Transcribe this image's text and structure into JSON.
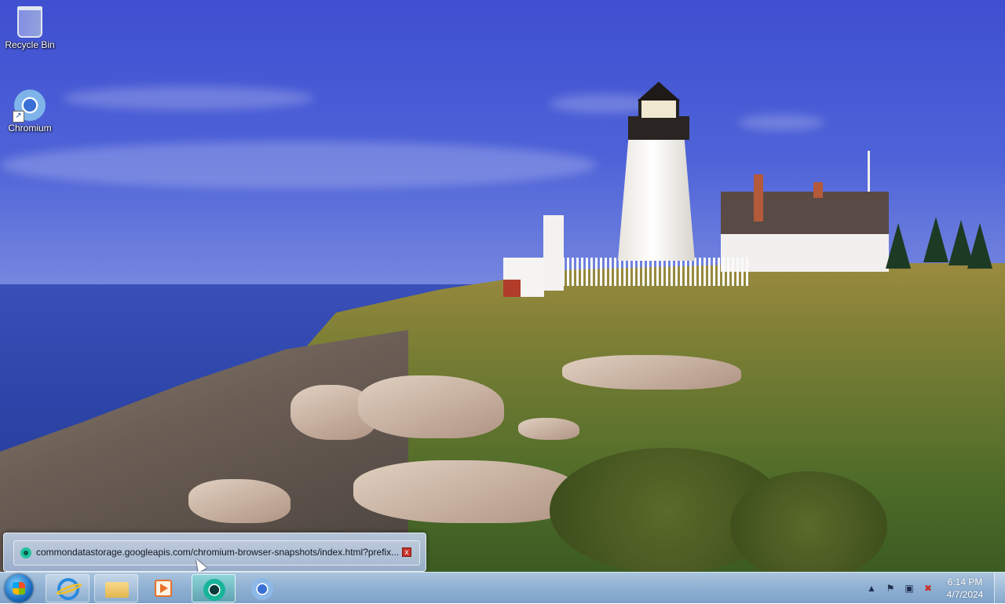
{
  "desktop": {
    "icons": [
      {
        "label": "Recycle Bin",
        "icon": "recycle-bin-icon"
      },
      {
        "label": "Chromium",
        "icon": "chromium-icon"
      }
    ]
  },
  "thumbnail": {
    "title": "commondatastorage.googleapis.com/chromium-browser-snapshots/index.html?prefix...",
    "app_icon": "chromium-icon",
    "close_label": "x"
  },
  "taskbar": {
    "start_icon": "windows-start-icon",
    "pinned": [
      {
        "icon": "internet-explorer-icon"
      },
      {
        "icon": "file-explorer-icon"
      },
      {
        "icon": "media-player-icon"
      },
      {
        "icon": "chromium-icon",
        "active": true
      },
      {
        "icon": "chrome-icon"
      }
    ],
    "tray": {
      "show_hidden_icon": "chevron-up-icon",
      "icons": [
        "action-center-flag-icon",
        "network-icon",
        "volume-muted-icon"
      ],
      "time": "6:14 PM",
      "date": "4/7/2024"
    }
  },
  "colors": {
    "taskbar": "#8fb0d2",
    "active_button": "#3ca096",
    "close_button": "#c8322a"
  }
}
